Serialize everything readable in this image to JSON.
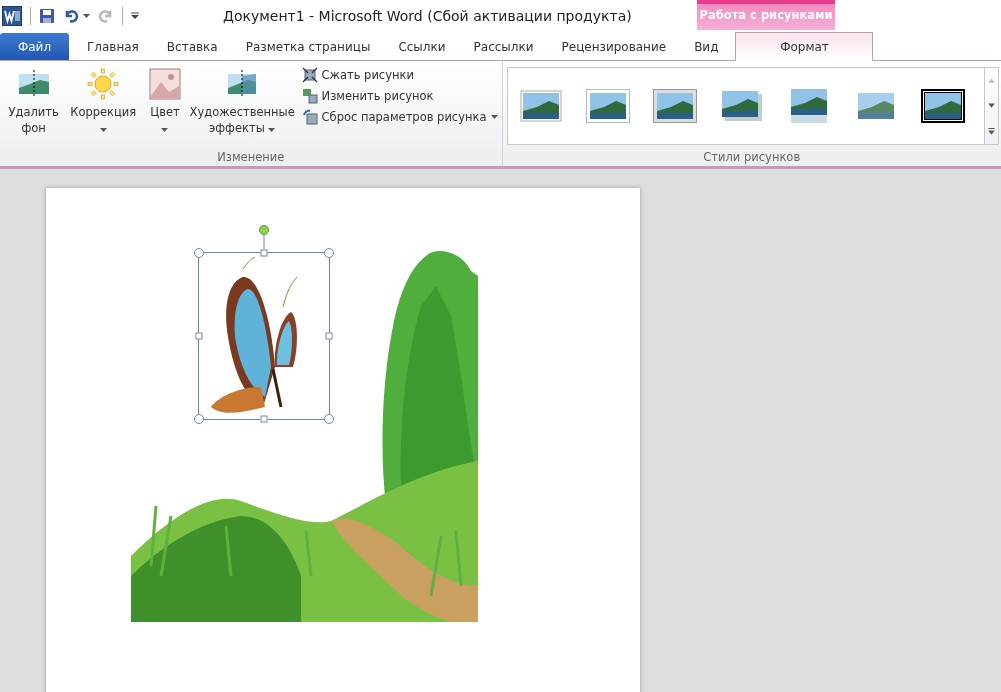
{
  "window": {
    "title": "Документ1  -  Microsoft Word (Сбой активации продукта)"
  },
  "quick_access": [
    {
      "kind": "save",
      "disabled": false
    },
    {
      "kind": "undo",
      "disabled": false
    },
    {
      "kind": "redo",
      "disabled": true
    }
  ],
  "contextual_tab": {
    "label": "Работа с рисунками"
  },
  "tabs": [
    {
      "label": "Файл",
      "kind": "file",
      "selected": false
    },
    {
      "label": "Главная",
      "kind": "normal",
      "selected": false
    },
    {
      "label": "Вставка",
      "kind": "normal",
      "selected": false
    },
    {
      "label": "Разметка страницы",
      "kind": "normal",
      "selected": false
    },
    {
      "label": "Ссылки",
      "kind": "normal",
      "selected": false
    },
    {
      "label": "Рассылки",
      "kind": "normal",
      "selected": false
    },
    {
      "label": "Рецензирование",
      "kind": "normal",
      "selected": false
    },
    {
      "label": "Вид",
      "kind": "normal",
      "selected": false
    },
    {
      "label": "Формат",
      "kind": "contextual",
      "selected": true
    }
  ],
  "groups": [
    {
      "label": "Изменение",
      "large_buttons": [
        {
          "label": "Удалить фон",
          "kind": "remove-bg",
          "dropdown": false
        },
        {
          "label": "Коррекция",
          "kind": "sun",
          "dropdown": true
        },
        {
          "label": "Цвет",
          "kind": "color",
          "dropdown": true
        },
        {
          "label": "Художественные эффекты",
          "kind": "art",
          "dropdown": true
        }
      ],
      "small_buttons": [
        {
          "label": "Сжать рисунки",
          "kind": "compress",
          "dropdown": false
        },
        {
          "label": "Изменить рисунок",
          "kind": "change",
          "dropdown": false
        },
        {
          "label": "Сброс параметров рисунка",
          "kind": "reset",
          "dropdown": true
        }
      ]
    },
    {
      "label": "Стили рисунков",
      "gallery": [
        {
          "kind": "simple-frame"
        },
        {
          "kind": "white-frame"
        },
        {
          "kind": "gray-frame"
        },
        {
          "kind": "drop-shadow"
        },
        {
          "kind": "reflection"
        },
        {
          "kind": "soft-edges"
        },
        {
          "kind": "black-frame"
        }
      ]
    }
  ],
  "document": {
    "pictures": [
      {
        "kind": "landscape",
        "selected": false
      },
      {
        "kind": "butterfly",
        "selected": true
      }
    ]
  }
}
